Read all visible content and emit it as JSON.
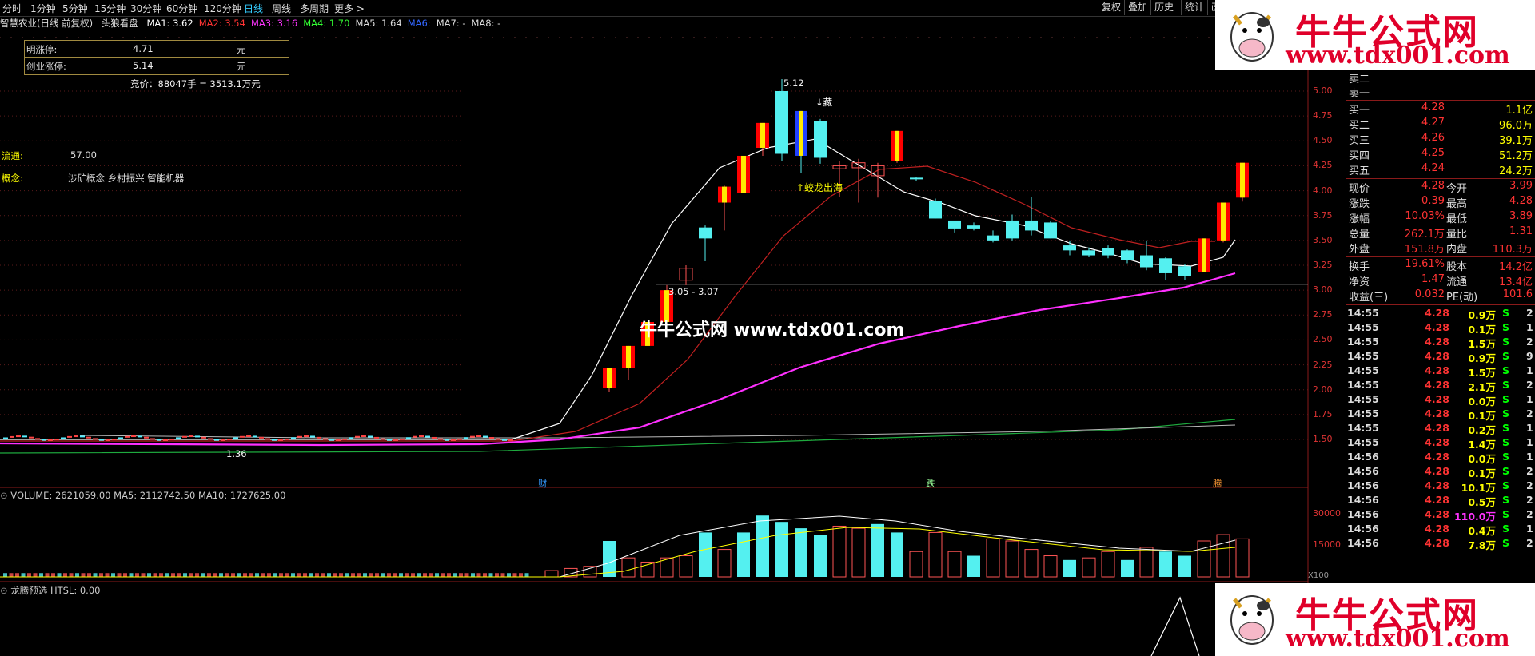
{
  "toolbar": {
    "periods": [
      "分时",
      "1分钟",
      "5分钟",
      "15分钟",
      "30分钟",
      "60分钟",
      "120分钟",
      "日线",
      "周线",
      "多周期",
      "更多 >"
    ],
    "active": "日线",
    "right_buttons": [
      "复权",
      "叠加",
      "历史",
      "统计",
      "画线"
    ]
  },
  "header": {
    "stock": "智慧农业(日线 前复权)",
    "indicator": "头狼看盘",
    "ma": [
      {
        "label": "MA1: 3.62",
        "color": "#ffffff"
      },
      {
        "label": "MA2: 3.54",
        "color": "#ff3333"
      },
      {
        "label": "MA3: 3.16",
        "color": "#ff33ff"
      },
      {
        "label": "MA4: 1.70",
        "color": "#33ff33"
      },
      {
        "label": "MA5: 1.64",
        "color": "#dddddd"
      },
      {
        "label": "MA6:",
        "color": "#3366ff"
      },
      {
        "label": "MA7: -",
        "color": "#dddddd"
      },
      {
        "label": "MA8: -",
        "color": "#dddddd"
      }
    ]
  },
  "infobox": {
    "rows": [
      {
        "label": "明涨停:",
        "value": "4.71",
        "unit": "元"
      },
      {
        "label": "创业涨停:",
        "value": "5.14",
        "unit": "元"
      }
    ],
    "auction": "竞价：88047手 = 3513.1万元"
  },
  "side": {
    "float_label": "流通:",
    "float_value": "57.00",
    "concept_label": "概念:",
    "concept_value": "涉矿概念 乡村振兴 智能机器"
  },
  "chart_annotations": {
    "high": "5.12",
    "low": "1.36",
    "range": "3.05 - 3.07",
    "tag1": "↓藏",
    "tag2": "↑蛟龙出海",
    "marks": [
      "财",
      "跌",
      "腾"
    ]
  },
  "chart_data": {
    "type": "candlestick",
    "y_ticks": [
      5.0,
      4.75,
      4.5,
      4.25,
      4.0,
      3.75,
      3.5,
      3.25,
      3.0,
      2.75,
      2.5,
      2.25,
      2.0,
      1.75,
      1.5
    ],
    "candles": [
      {
        "o": 2.02,
        "c": 2.22,
        "h": 2.22,
        "l": 1.98
      },
      {
        "o": 2.22,
        "c": 2.44,
        "h": 2.44,
        "l": 2.1
      },
      {
        "o": 2.44,
        "c": 2.68,
        "h": 2.68,
        "l": 2.44
      },
      {
        "o": 2.68,
        "c": 3.0,
        "h": 3.05,
        "l": 2.66
      },
      {
        "o": 3.1,
        "c": 3.22,
        "h": 3.25,
        "l": 3.05
      },
      {
        "o": 3.63,
        "c": 3.52,
        "h": 3.65,
        "l": 3.29
      },
      {
        "o": 3.88,
        "c": 4.04,
        "h": 4.05,
        "l": 3.6
      },
      {
        "o": 3.98,
        "c": 4.35,
        "h": 4.35,
        "l": 3.98
      },
      {
        "o": 4.43,
        "c": 4.68,
        "h": 4.68,
        "l": 4.35
      },
      {
        "o": 5.0,
        "c": 4.37,
        "h": 5.12,
        "l": 4.3
      },
      {
        "o": 4.8,
        "c": 4.35,
        "h": 4.8,
        "l": 4.18
      },
      {
        "o": 4.7,
        "c": 4.33,
        "h": 4.72,
        "l": 4.27
      },
      {
        "o": 4.22,
        "c": 4.25,
        "h": 4.3,
        "l": 3.94
      },
      {
        "o": 4.23,
        "c": 4.28,
        "h": 4.32,
        "l": 3.88
      },
      {
        "o": 4.15,
        "c": 4.25,
        "h": 4.28,
        "l": 3.93
      },
      {
        "o": 4.3,
        "c": 4.6,
        "h": 4.6,
        "l": 4.28
      },
      {
        "o": 4.13,
        "c": 4.12,
        "h": 4.14,
        "l": 4.1
      },
      {
        "o": 3.9,
        "c": 3.72,
        "h": 3.92,
        "l": 3.72
      },
      {
        "o": 3.7,
        "c": 3.62,
        "h": 3.7,
        "l": 3.58
      },
      {
        "o": 3.65,
        "c": 3.62,
        "h": 3.68,
        "l": 3.6
      },
      {
        "o": 3.55,
        "c": 3.5,
        "h": 3.6,
        "l": 3.48
      },
      {
        "o": 3.7,
        "c": 3.52,
        "h": 3.76,
        "l": 3.5
      },
      {
        "o": 3.7,
        "c": 3.6,
        "h": 3.94,
        "l": 3.55
      },
      {
        "o": 3.68,
        "c": 3.52,
        "h": 3.7,
        "l": 3.52
      },
      {
        "o": 3.45,
        "c": 3.4,
        "h": 3.5,
        "l": 3.35
      },
      {
        "o": 3.4,
        "c": 3.35,
        "h": 3.43,
        "l": 3.33
      },
      {
        "o": 3.42,
        "c": 3.35,
        "h": 3.45,
        "l": 3.32
      },
      {
        "o": 3.4,
        "c": 3.3,
        "h": 3.41,
        "l": 3.27
      },
      {
        "o": 3.35,
        "c": 3.23,
        "h": 3.5,
        "l": 3.2
      },
      {
        "o": 3.32,
        "c": 3.17,
        "h": 3.33,
        "l": 3.1
      },
      {
        "o": 3.24,
        "c": 3.14,
        "h": 3.26,
        "l": 3.1
      },
      {
        "o": 3.18,
        "c": 3.52,
        "h": 3.52,
        "l": 3.18
      },
      {
        "o": 3.5,
        "c": 3.88,
        "h": 3.88,
        "l": 3.48
      },
      {
        "o": 3.93,
        "c": 4.28,
        "h": 4.28,
        "l": 3.89
      }
    ],
    "volume_ticks": [
      30000,
      15000
    ]
  },
  "volume": {
    "label": "VOLUME: 2621059.00  MA5: 2112742.50  MA10: 1727625.00",
    "scale": "X100"
  },
  "indicator2": {
    "label": "龙腾预选 HTSL: 0.00"
  },
  "quote": {
    "sells": [
      "卖二",
      "卖一"
    ],
    "buys": [
      {
        "k": "买一",
        "p": "4.28",
        "v": "1.1亿"
      },
      {
        "k": "买二",
        "p": "4.27",
        "v": "96.0万"
      },
      {
        "k": "买三",
        "p": "4.26",
        "v": "39.1万"
      },
      {
        "k": "买四",
        "p": "4.25",
        "v": "51.2万"
      },
      {
        "k": "买五",
        "p": "4.24",
        "v": "24.2万"
      }
    ],
    "stats": [
      {
        "k1": "现价",
        "v1": "4.28",
        "k2": "今开",
        "v2": "3.99"
      },
      {
        "k1": "涨跌",
        "v1": "0.39",
        "k2": "最高",
        "v2": "4.28"
      },
      {
        "k1": "涨幅",
        "v1": "10.03%",
        "k2": "最低",
        "v2": "3.89"
      },
      {
        "k1": "总量",
        "v1": "262.1万",
        "k2": "量比",
        "v2": "1.31"
      },
      {
        "k1": "外盘",
        "v1": "151.8万",
        "k2": "内盘",
        "v2": "110.3万"
      }
    ],
    "stats2": [
      {
        "k1": "换手",
        "v1": "19.61%",
        "k2": "股本",
        "v2": "14.2亿"
      },
      {
        "k1": "净资",
        "v1": "1.47",
        "k2": "流通",
        "v2": "13.4亿"
      },
      {
        "k1": "收益(三)",
        "v1": "0.032",
        "k2": "PE(动)",
        "v2": "101.6"
      }
    ],
    "trades": [
      {
        "t": "14:55",
        "p": "4.28",
        "v": "0.9万",
        "s": "S",
        "n": "2"
      },
      {
        "t": "14:55",
        "p": "4.28",
        "v": "0.1万",
        "s": "S",
        "n": "1"
      },
      {
        "t": "14:55",
        "p": "4.28",
        "v": "1.5万",
        "s": "S",
        "n": "2"
      },
      {
        "t": "14:55",
        "p": "4.28",
        "v": "0.9万",
        "s": "S",
        "n": "9"
      },
      {
        "t": "14:55",
        "p": "4.28",
        "v": "1.5万",
        "s": "S",
        "n": "1"
      },
      {
        "t": "14:55",
        "p": "4.28",
        "v": "2.1万",
        "s": "S",
        "n": "2"
      },
      {
        "t": "14:55",
        "p": "4.28",
        "v": "0.0万",
        "s": "S",
        "n": "1"
      },
      {
        "t": "14:55",
        "p": "4.28",
        "v": "0.1万",
        "s": "S",
        "n": "2"
      },
      {
        "t": "14:55",
        "p": "4.28",
        "v": "0.2万",
        "s": "S",
        "n": "1"
      },
      {
        "t": "14:55",
        "p": "4.28",
        "v": "1.4万",
        "s": "S",
        "n": "1"
      },
      {
        "t": "14:56",
        "p": "4.28",
        "v": "0.0万",
        "s": "S",
        "n": "1"
      },
      {
        "t": "14:56",
        "p": "4.28",
        "v": "0.1万",
        "s": "S",
        "n": "2"
      },
      {
        "t": "14:56",
        "p": "4.28",
        "v": "10.1万",
        "s": "S",
        "n": "2"
      },
      {
        "t": "14:56",
        "p": "4.28",
        "v": "0.5万",
        "s": "S",
        "n": "2"
      },
      {
        "t": "14:56",
        "p": "4.28",
        "v": "110.0万",
        "s": "S",
        "n": "2"
      },
      {
        "t": "14:56",
        "p": "4.28",
        "v": "0.4万",
        "s": "S",
        "n": "1"
      },
      {
        "t": "14:56",
        "p": "4.28",
        "v": "7.8万",
        "s": "S",
        "n": "2"
      }
    ]
  },
  "watermark": {
    "center": "牛牛公式网 www.tdx001.com",
    "logo_title": "牛牛公式网",
    "logo_url": "www.tdx001.com"
  }
}
